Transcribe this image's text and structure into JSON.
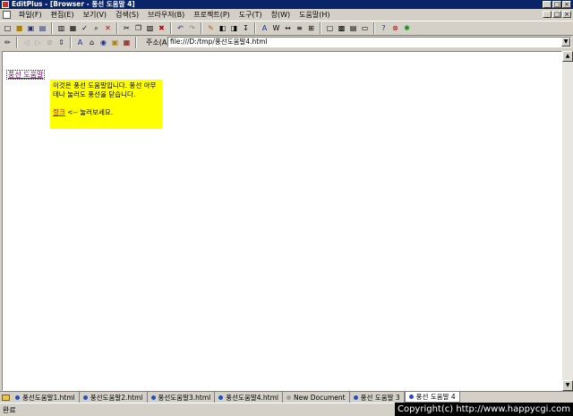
{
  "window": {
    "title": "EditPlus - [Browser - 풍선 도움말 4]",
    "buttons": [
      "_",
      "□",
      "×"
    ]
  },
  "menu": [
    "파일(F)",
    "편집(E)",
    "보기(V)",
    "검색(S)",
    "브라우저(B)",
    "프로젝트(P)",
    "도구(T)",
    "창(W)",
    "도움말(H)"
  ],
  "address": {
    "label": "주소(A)",
    "value": "file:///D:/tmp/풍선도움말4.html"
  },
  "page": {
    "balloon_link": "풍선 도움말",
    "tooltip_line1": "이것은 풍선 도움말입니다. 풍선 아무데나 눌러도 풍선을 닫습니다.",
    "tooltip_link": "링크",
    "tooltip_after": " <-- 눌러보세요."
  },
  "tabs": [
    "풍선도움말1.html",
    "풍선도움말2.html",
    "풍선도움말3.html",
    "풍선도움말4.html",
    "New Document",
    "풍선 도움말 3",
    "풍선 도움말 4"
  ],
  "status": "완료",
  "copyright": "Copyright(c) http://www.happycgi.com"
}
